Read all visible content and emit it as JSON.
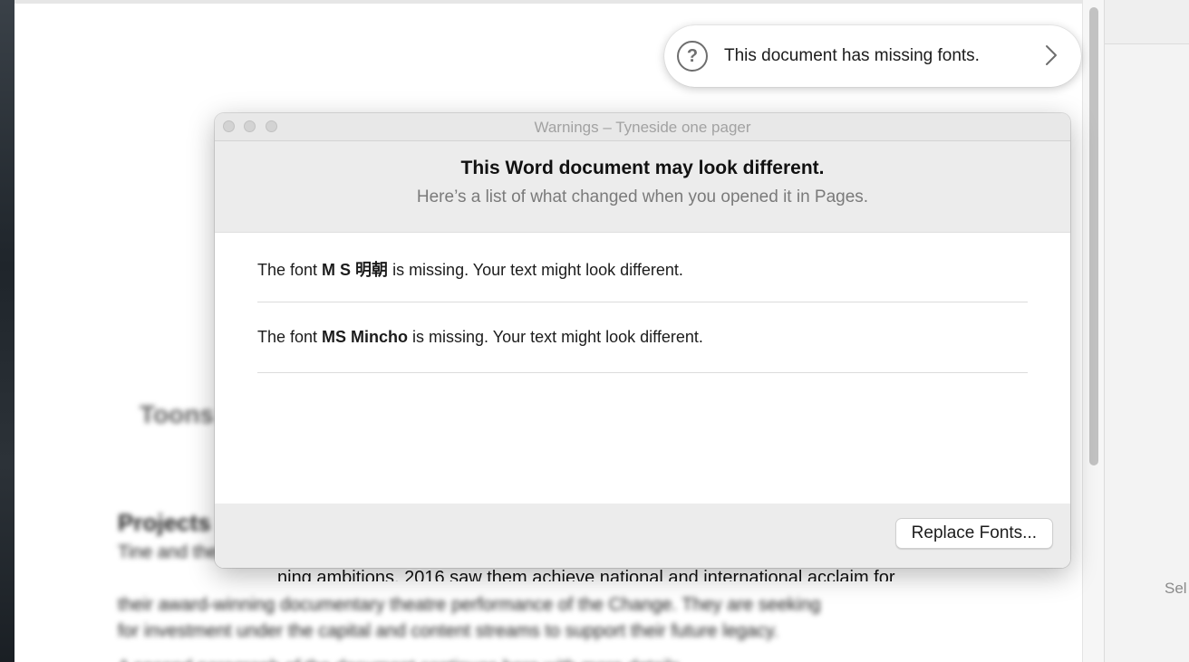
{
  "banner": {
    "icon": "question-circle-icon",
    "text": "This document has missing fonts."
  },
  "dialog": {
    "title": "Warnings – Tyneside one pager",
    "heading": "This Word document may look different.",
    "subheading": "Here’s a list of what changed when you opened it in Pages.",
    "warnings": [
      {
        "prefix": "The font ",
        "font": "M S 明朝",
        "suffix": " is missing. Your text might look different."
      },
      {
        "prefix": "The font ",
        "font": "MS Mincho",
        "suffix": " is missing. Your text might look different."
      }
    ],
    "replace_button": "Replace Fonts..."
  },
  "document": {
    "visible_line": "ning ambitions. 2016 saw them achieve national and international acclaim for",
    "fragment_a": "s",
    "fragment_b": "S",
    "fragment_c": "l"
  },
  "sidebar": {
    "hint": "Sel"
  },
  "colors": {
    "desktop": "#2a3036",
    "dialog_header": "#ececec",
    "titlebar": "#e8e8e8"
  }
}
